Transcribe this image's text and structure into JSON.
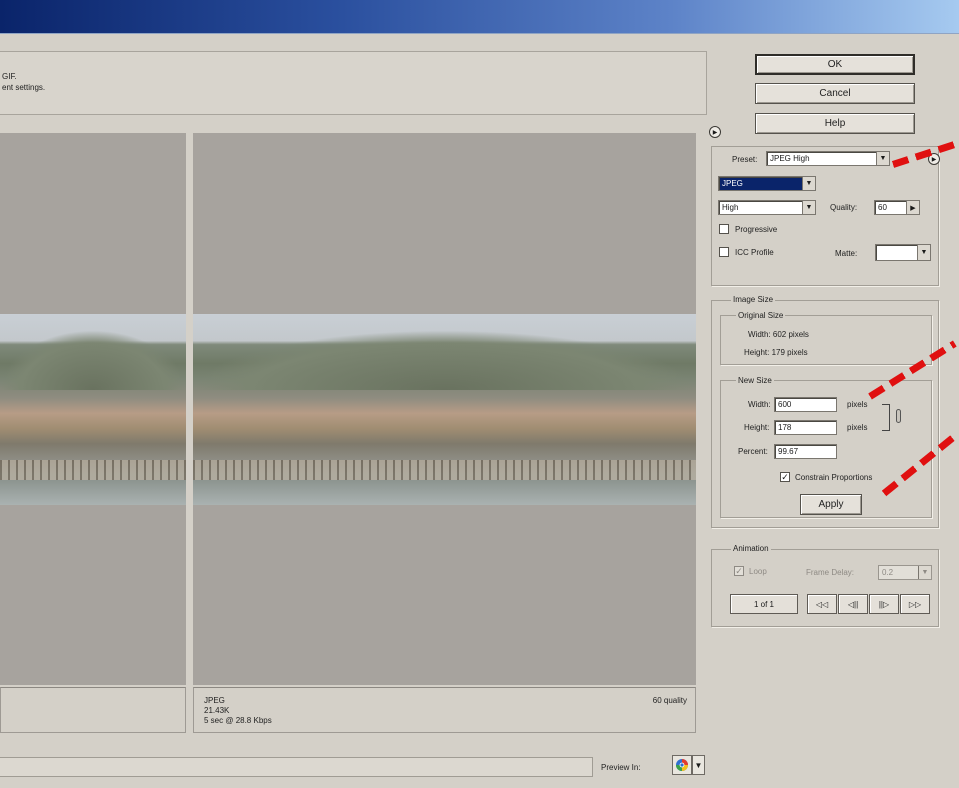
{
  "window": {
    "title": ""
  },
  "info": {
    "line1": "GIF.",
    "line2": "ent settings."
  },
  "preview": {
    "left_footer": "",
    "right_footer": {
      "format": "JPEG",
      "size": "21.43K",
      "time": "5 sec @ 28.8 Kbps",
      "quality": "60 quality"
    }
  },
  "buttons": {
    "ok": "OK",
    "cancel": "Cancel",
    "help": "Help",
    "apply": "Apply"
  },
  "settings": {
    "preset_label": "Preset:",
    "preset_value": "JPEG High",
    "format_value": "JPEG",
    "quality_level": "High",
    "quality_label": "Quality:",
    "quality_value": "60",
    "progressive_label": "Progressive",
    "progressive_checked": false,
    "icc_label": "ICC Profile",
    "icc_checked": false,
    "matte_label": "Matte:"
  },
  "image_size": {
    "title": "Image Size",
    "original_title": "Original Size",
    "original_width": "Width: 602 pixels",
    "original_height": "Height: 179 pixels",
    "new_title": "New Size",
    "width_label": "Width:",
    "width_value": "600",
    "height_label": "Height:",
    "height_value": "178",
    "unit": "pixels",
    "percent_label": "Percent:",
    "percent_value": "99.67",
    "constrain_label": "Constrain Proportions",
    "constrain_checked": true
  },
  "animation": {
    "title": "Animation",
    "loop_label": "Loop",
    "loop_checked": true,
    "frame_delay_label": "Frame Delay:",
    "frame_delay_value": "0.2",
    "frame_counter": "1 of 1",
    "controls": [
      "◁◁",
      "◁||",
      "||▷",
      "▷▷"
    ]
  },
  "statusbar": {
    "text": "",
    "preview_in_label": "Preview In:",
    "browser_icon": "web-browser-icon"
  },
  "colors": {
    "dialog_bg": "#d4d0c8",
    "annotation_red": "#e01010",
    "selection_blue": "#0a246a"
  }
}
